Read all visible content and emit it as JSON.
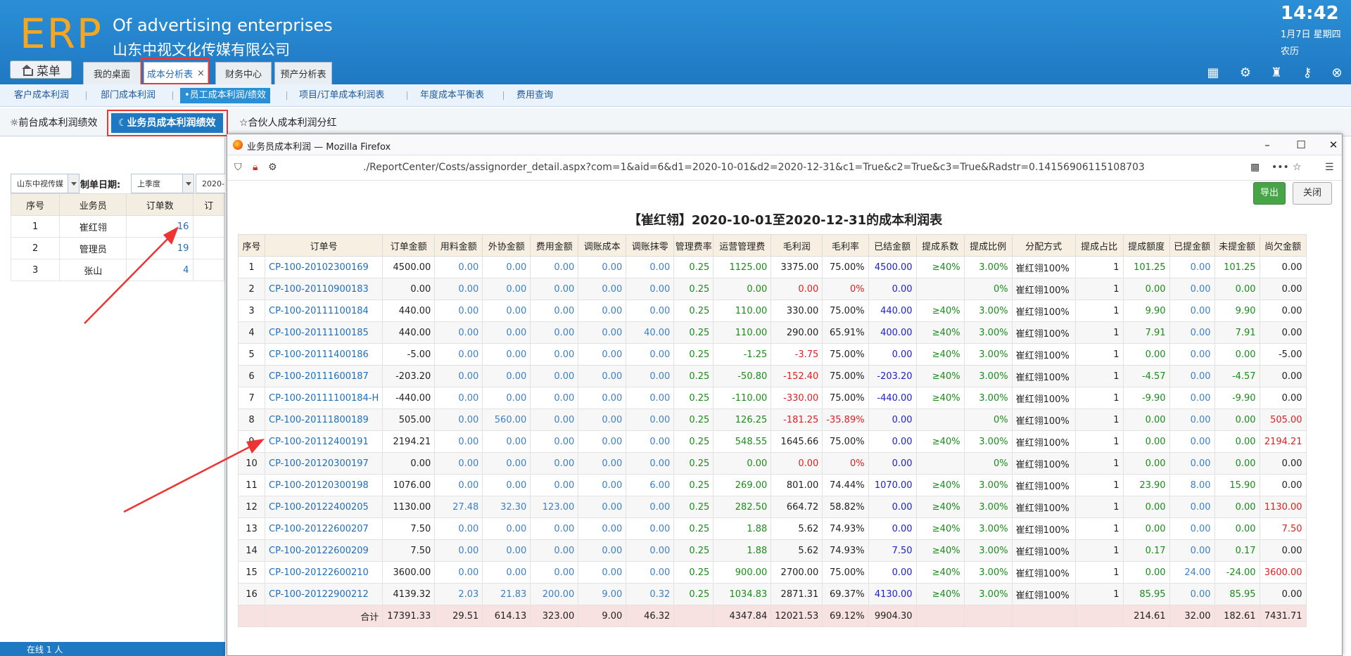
{
  "header": {
    "logo": "ERP",
    "brand_en": "Of advertising enterprises",
    "brand_cn": "山东中视文化传媒有限公司",
    "clock": "14:42",
    "date": "1月7日 星期四",
    "lunar": "农历"
  },
  "menu_label": "菜单",
  "top_tabs": [
    "我的桌面",
    "成本分析表",
    "财务中心",
    "预产分析表"
  ],
  "tab_close": "×",
  "subnav": [
    "客户成本利润",
    "部门成本利润",
    "•员工成本利润/绩效",
    "项目/订单成本利润表",
    "年度成本平衡表",
    "费用查询"
  ],
  "tabs3": [
    "☼前台成本利润绩效",
    "☾业务员成本利润绩效",
    "☆合伙人成本利润分红"
  ],
  "left": {
    "company": "山东中视传媒",
    "date_label": "制单日期:",
    "period": "上季度",
    "date_value": "2020-",
    "headers": [
      "序号",
      "业务员",
      "订单数",
      "订"
    ],
    "rows": [
      {
        "no": "1",
        "name": "崔红翎",
        "count": "16"
      },
      {
        "no": "2",
        "name": "管理员",
        "count": "19"
      },
      {
        "no": "3",
        "name": "张山",
        "count": "4"
      }
    ],
    "status": "在线  1  人"
  },
  "popup": {
    "title": "业务员成本利润 — Mozilla Firefox",
    "url": "./ReportCenter/Costs/assignorder_detail.aspx?com=1&aid=6&d1=2020-10-01&d2=2020-12-31&c1=True&c2=True&c3=True&Radstr=0.14156906115108703",
    "win_min": "–",
    "win_max": "☐",
    "win_close": "✕",
    "btn_export": "导出",
    "btn_close": "关闭",
    "report_title": "【崔红翎】2020-10-01至2020-12-31的成本利润表",
    "headers": [
      "序号",
      "订单号",
      "订单金额",
      "用料金额",
      "外协金额",
      "费用金额",
      "调账成本",
      "调账抹零",
      "管理费率",
      "运营管理费",
      "毛利润",
      "毛利率",
      "已结金额",
      "提成系数",
      "提成比例",
      "分配方式",
      "提成占比",
      "提成额度",
      "已提金额",
      "未提金额",
      "尚欠金额"
    ],
    "rows": [
      [
        "1",
        "CP-100-20102300169",
        "4500.00",
        "0.00",
        "0.00",
        "0.00",
        "0.00",
        "0.00",
        "0.25",
        "1125.00",
        "3375.00",
        "75.00%",
        "4500.00",
        "≥40%",
        "3.00%",
        "崔红翎100%",
        "1",
        "101.25",
        "0.00",
        "101.25",
        "0.00"
      ],
      [
        "2",
        "CP-100-20110900183",
        "0.00",
        "0.00",
        "0.00",
        "0.00",
        "0.00",
        "0.00",
        "0.25",
        "0.00",
        "0.00",
        "0%",
        "0.00",
        "",
        "0%",
        "崔红翎100%",
        "1",
        "0.00",
        "0.00",
        "0.00",
        "0.00"
      ],
      [
        "3",
        "CP-100-20111100184",
        "440.00",
        "0.00",
        "0.00",
        "0.00",
        "0.00",
        "0.00",
        "0.25",
        "110.00",
        "330.00",
        "75.00%",
        "440.00",
        "≥40%",
        "3.00%",
        "崔红翎100%",
        "1",
        "9.90",
        "0.00",
        "9.90",
        "0.00"
      ],
      [
        "4",
        "CP-100-20111100185",
        "440.00",
        "0.00",
        "0.00",
        "0.00",
        "0.00",
        "40.00",
        "0.25",
        "110.00",
        "290.00",
        "65.91%",
        "400.00",
        "≥40%",
        "3.00%",
        "崔红翎100%",
        "1",
        "7.91",
        "0.00",
        "7.91",
        "0.00"
      ],
      [
        "5",
        "CP-100-20111400186",
        "-5.00",
        "0.00",
        "0.00",
        "0.00",
        "0.00",
        "0.00",
        "0.25",
        "-1.25",
        "-3.75",
        "75.00%",
        "0.00",
        "≥40%",
        "3.00%",
        "崔红翎100%",
        "1",
        "0.00",
        "0.00",
        "0.00",
        "-5.00"
      ],
      [
        "6",
        "CP-100-20111600187",
        "-203.20",
        "0.00",
        "0.00",
        "0.00",
        "0.00",
        "0.00",
        "0.25",
        "-50.80",
        "-152.40",
        "75.00%",
        "-203.20",
        "≥40%",
        "3.00%",
        "崔红翎100%",
        "1",
        "-4.57",
        "0.00",
        "-4.57",
        "0.00"
      ],
      [
        "7",
        "CP-100-20111100184-H",
        "-440.00",
        "0.00",
        "0.00",
        "0.00",
        "0.00",
        "0.00",
        "0.25",
        "-110.00",
        "-330.00",
        "75.00%",
        "-440.00",
        "≥40%",
        "3.00%",
        "崔红翎100%",
        "1",
        "-9.90",
        "0.00",
        "-9.90",
        "0.00"
      ],
      [
        "8",
        "CP-100-20111800189",
        "505.00",
        "0.00",
        "560.00",
        "0.00",
        "0.00",
        "0.00",
        "0.25",
        "126.25",
        "-181.25",
        "-35.89%",
        "0.00",
        "",
        "0%",
        "崔红翎100%",
        "1",
        "0.00",
        "0.00",
        "0.00",
        "505.00"
      ],
      [
        "9",
        "CP-100-20112400191",
        "2194.21",
        "0.00",
        "0.00",
        "0.00",
        "0.00",
        "0.00",
        "0.25",
        "548.55",
        "1645.66",
        "75.00%",
        "0.00",
        "≥40%",
        "3.00%",
        "崔红翎100%",
        "1",
        "0.00",
        "0.00",
        "0.00",
        "2194.21"
      ],
      [
        "10",
        "CP-100-20120300197",
        "0.00",
        "0.00",
        "0.00",
        "0.00",
        "0.00",
        "0.00",
        "0.25",
        "0.00",
        "0.00",
        "0%",
        "0.00",
        "",
        "0%",
        "崔红翎100%",
        "1",
        "0.00",
        "0.00",
        "0.00",
        "0.00"
      ],
      [
        "11",
        "CP-100-20120300198",
        "1076.00",
        "0.00",
        "0.00",
        "0.00",
        "0.00",
        "6.00",
        "0.25",
        "269.00",
        "801.00",
        "74.44%",
        "1070.00",
        "≥40%",
        "3.00%",
        "崔红翎100%",
        "1",
        "23.90",
        "8.00",
        "15.90",
        "0.00"
      ],
      [
        "12",
        "CP-100-20122400205",
        "1130.00",
        "27.48",
        "32.30",
        "123.00",
        "0.00",
        "0.00",
        "0.25",
        "282.50",
        "664.72",
        "58.82%",
        "0.00",
        "≥40%",
        "3.00%",
        "崔红翎100%",
        "1",
        "0.00",
        "0.00",
        "0.00",
        "1130.00"
      ],
      [
        "13",
        "CP-100-20122600207",
        "7.50",
        "0.00",
        "0.00",
        "0.00",
        "0.00",
        "0.00",
        "0.25",
        "1.88",
        "5.62",
        "74.93%",
        "0.00",
        "≥40%",
        "3.00%",
        "崔红翎100%",
        "1",
        "0.00",
        "0.00",
        "0.00",
        "7.50"
      ],
      [
        "14",
        "CP-100-20122600209",
        "7.50",
        "0.00",
        "0.00",
        "0.00",
        "0.00",
        "0.00",
        "0.25",
        "1.88",
        "5.62",
        "74.93%",
        "7.50",
        "≥40%",
        "3.00%",
        "崔红翎100%",
        "1",
        "0.17",
        "0.00",
        "0.17",
        "0.00"
      ],
      [
        "15",
        "CP-100-20122600210",
        "3600.00",
        "0.00",
        "0.00",
        "0.00",
        "0.00",
        "0.00",
        "0.25",
        "900.00",
        "2700.00",
        "75.00%",
        "0.00",
        "≥40%",
        "3.00%",
        "崔红翎100%",
        "1",
        "0.00",
        "24.00",
        "-24.00",
        "3600.00"
      ],
      [
        "16",
        "CP-100-20122900212",
        "4139.32",
        "2.03",
        "21.83",
        "200.00",
        "9.00",
        "0.32",
        "0.25",
        "1034.83",
        "2871.31",
        "69.37%",
        "4130.00",
        "≥40%",
        "3.00%",
        "崔红翎100%",
        "1",
        "85.95",
        "0.00",
        "85.95",
        "0.00"
      ]
    ],
    "total": [
      "",
      "合计",
      "17391.33",
      "29.51",
      "614.13",
      "323.00",
      "9.00",
      "46.32",
      "",
      "4347.84",
      "12021.53",
      "69.12%",
      "9904.30",
      "",
      "",
      "",
      "",
      "214.61",
      "32.00",
      "182.61",
      "7431.71"
    ]
  }
}
